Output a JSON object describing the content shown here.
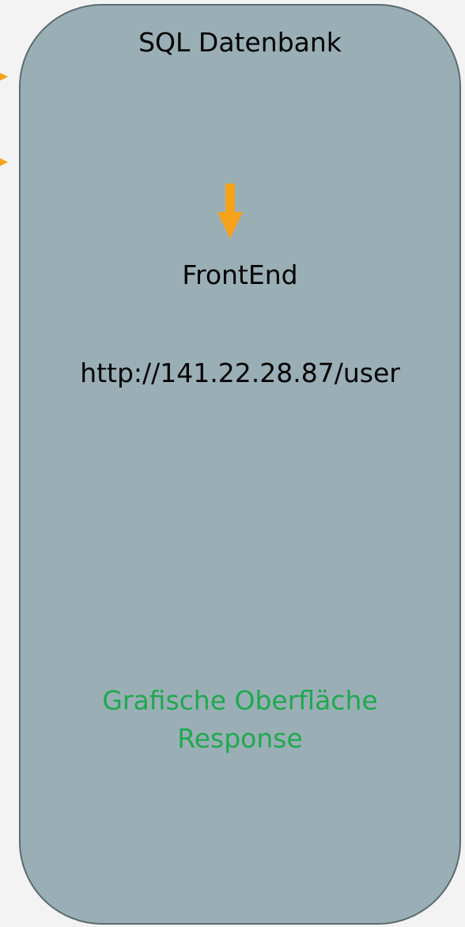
{
  "panel": {
    "title": "SQL Datenbank",
    "step_label": "FrontEnd",
    "endpoint_url": "http://141.22.28.87/user",
    "output_line1": "Grafische Oberfläche",
    "output_line2": "Response"
  },
  "colors": {
    "panel_fill": "#9aafb5",
    "panel_border": "#5c6b70",
    "arrow": "#f7a21b",
    "output_text": "#1fa84f",
    "background": "#f3f3f3"
  },
  "icons": {
    "flow_arrow": "down-arrow-icon",
    "edge_arrows": "right-arrow-icon"
  }
}
